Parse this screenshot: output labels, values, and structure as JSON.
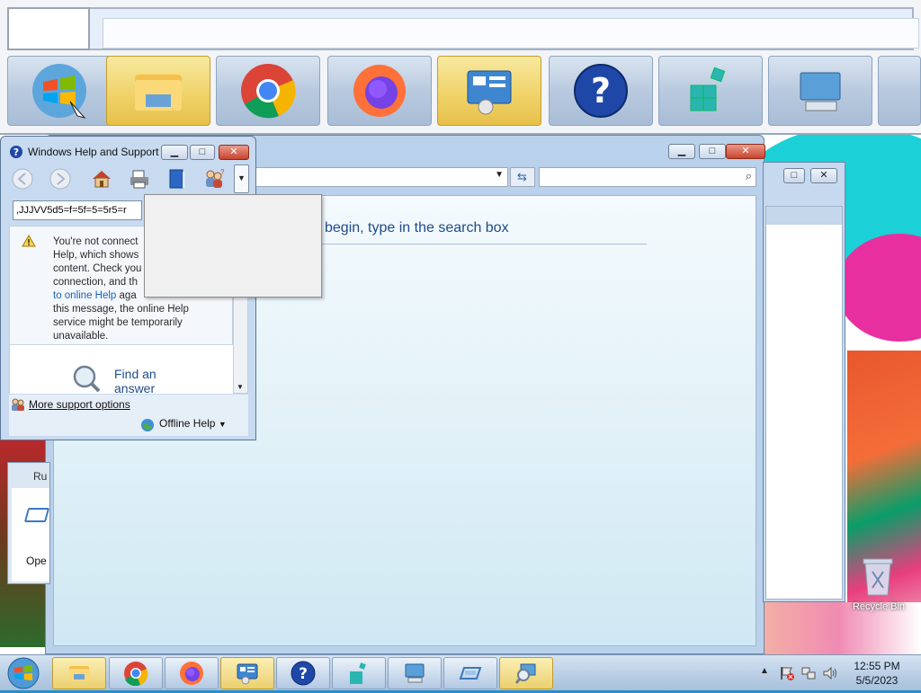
{
  "help_window": {
    "title": "Windows Help and Support",
    "minimize_label": "▭",
    "maximize_label": "□",
    "close_label": "✕",
    "search_value": ",JJJVV5d5=f=5f=5=5r5=r",
    "warning_lines": [
      "You're not connect",
      "Help, which shows",
      "content. Check you",
      "connection, and th",
      "to online Help",
      "aga",
      "this message, the online Help",
      "service might be temporarily",
      "unavailable."
    ],
    "find_answer": "Find an answer",
    "find_answer_line1": "Find an",
    "find_answer_line2": "answer",
    "more_support": "More support options",
    "offline_help": "Offline Help"
  },
  "main_window": {
    "heading": "begin, type in the search box"
  },
  "run_dialog": {
    "title_fragment": "Ru",
    "open_fragment": "Ope"
  },
  "desktop": {
    "recycle_bin": "Recycle Bin"
  },
  "taskbar": {
    "items": [
      {
        "name": "start-button",
        "icon": "windows-logo"
      },
      {
        "name": "file-explorer",
        "icon": "folder-icon"
      },
      {
        "name": "chrome",
        "icon": "chrome-icon"
      },
      {
        "name": "firefox",
        "icon": "firefox-icon"
      },
      {
        "name": "control-panel",
        "icon": "control-panel-icon"
      },
      {
        "name": "help-and-support",
        "icon": "help-icon"
      },
      {
        "name": "registry-editor",
        "icon": "registry-icon"
      },
      {
        "name": "on-screen-keyboard",
        "icon": "keyboard-icon"
      },
      {
        "name": "remote-desktop",
        "icon": "remote-icon"
      },
      {
        "name": "magnifier",
        "icon": "magnifier-icon"
      }
    ],
    "time": "12:55 PM",
    "date": "5/5/2023"
  },
  "colors": {
    "accent_blue": "#1f4b8a",
    "link_blue": "#1a63b5",
    "close_red": "#c8442d"
  }
}
